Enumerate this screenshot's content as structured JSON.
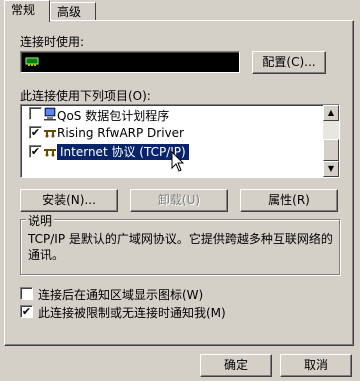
{
  "tabs": [
    {
      "label": "常规",
      "active": true
    },
    {
      "label": "高级",
      "active": false
    }
  ],
  "connect_using": {
    "label": "连接时使用:",
    "configure_button": "配置(C)..."
  },
  "components": {
    "label": "此连接使用下列项目(O):",
    "items": [
      {
        "label": "QoS 数据包计划程序",
        "checked": false,
        "selected": false,
        "icon": "network-service-icon"
      },
      {
        "label": "Rising RfwARP Driver",
        "checked": true,
        "selected": false,
        "icon": "protocol-icon"
      },
      {
        "label": "Internet 协议 (TCP/IP)",
        "checked": true,
        "selected": true,
        "icon": "protocol-icon"
      }
    ]
  },
  "buttons": {
    "install": "安装(N)...",
    "uninstall": "卸载(U)",
    "properties": "属性(R)",
    "ok": "确定",
    "cancel": "取消"
  },
  "description": {
    "title": "说明",
    "text": "TCP/IP 是默认的广域网协议。它提供跨越多种互联网络的通讯。"
  },
  "options": [
    {
      "label": "连接后在通知区域显示图标(W)",
      "checked": false
    },
    {
      "label": "此连接被限制或无连接时通知我(M)",
      "checked": true
    }
  ],
  "colors": {
    "face": "#d4d0c8",
    "selection": "#0a246a"
  }
}
